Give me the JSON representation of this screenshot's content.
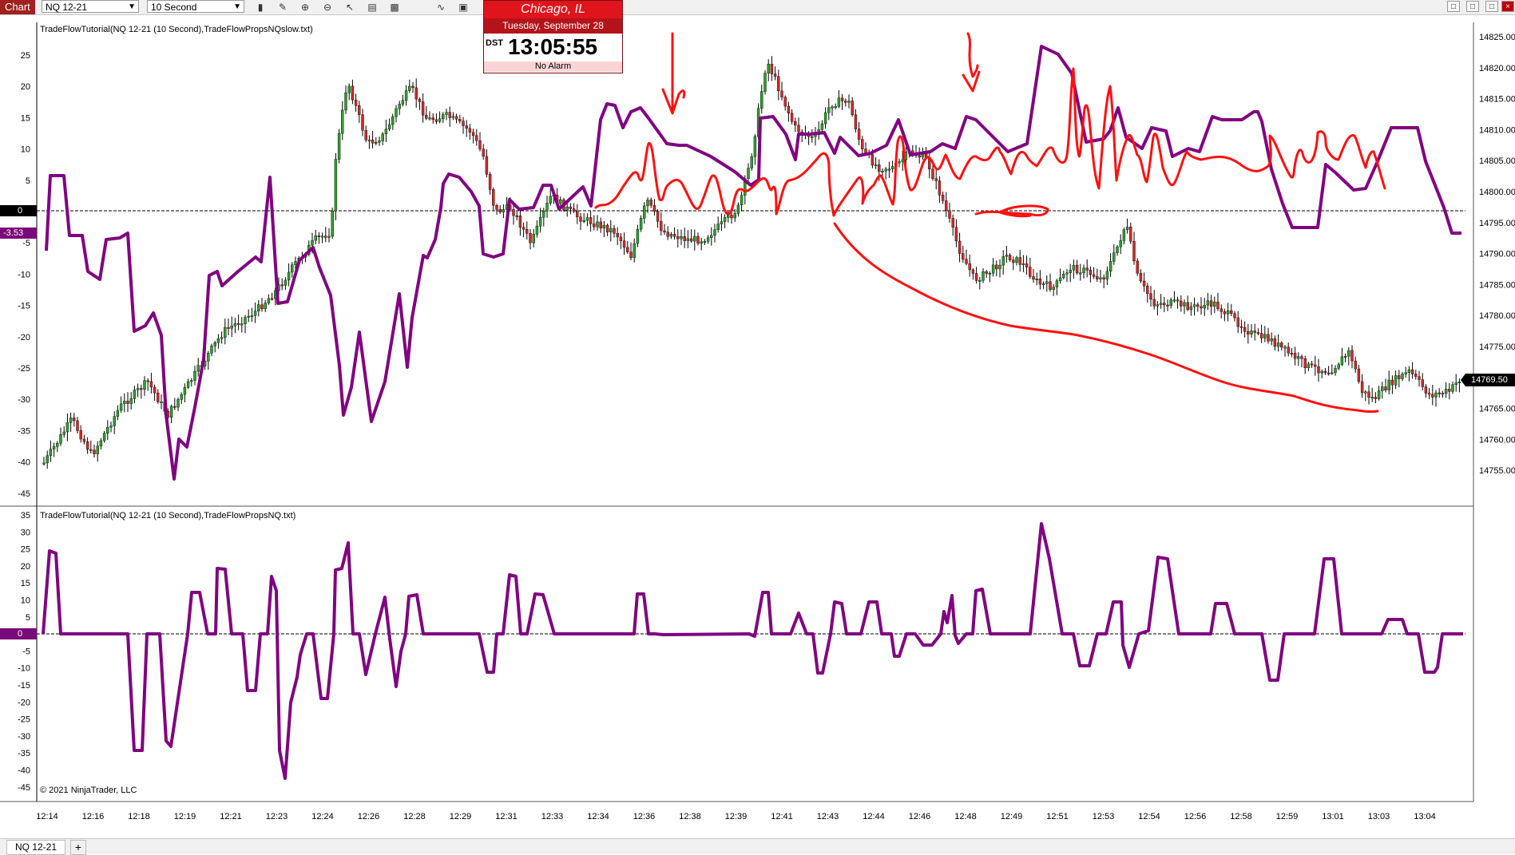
{
  "toolbar": {
    "chart_tab": "Chart",
    "instrument": "NQ 12-21",
    "interval": "10 Second"
  },
  "clock": {
    "city": "Chicago, IL",
    "date": "Tuesday, September 28",
    "dst": "DST",
    "time": "13:05:55",
    "alarm": "No Alarm"
  },
  "panels": {
    "top_title": "TradeFlowTutorial(NQ 12-21 (10 Second),TradeFlowPropsNQslow.txt)",
    "bottom_title": "TradeFlowTutorial(NQ 12-21 (10 Second),TradeFlowPropsNQ.txt)",
    "copyright": "© 2021 NinjaTrader, LLC"
  },
  "markers": {
    "top_zero": "0",
    "top_value": "-3.53",
    "bottom_zero": "0",
    "price": "14769.50"
  },
  "axes": {
    "left_top": [
      "25",
      "20",
      "15",
      "10",
      "5",
      "0",
      "-5",
      "-10",
      "-15",
      "-20",
      "-25",
      "-30",
      "-35",
      "-40",
      "-45"
    ],
    "left_bottom": [
      "35",
      "30",
      "25",
      "20",
      "15",
      "10",
      "5",
      "0",
      "-5",
      "-10",
      "-15",
      "-20",
      "-25",
      "-30",
      "-35",
      "-40",
      "-45"
    ],
    "right_price": [
      "14825.00",
      "14820.00",
      "14815.00",
      "14810.00",
      "14805.00",
      "14800.00",
      "14795.00",
      "14790.00",
      "14785.00",
      "14780.00",
      "14775.00",
      "14770.00",
      "14765.00",
      "14760.00",
      "14755.00"
    ],
    "time": [
      "12:14",
      "12:16",
      "12:18",
      "12:19",
      "12:21",
      "12:23",
      "12:24",
      "12:26",
      "12:28",
      "12:29",
      "12:31",
      "12:33",
      "12:34",
      "12:36",
      "12:38",
      "12:39",
      "12:41",
      "12:43",
      "12:44",
      "12:46",
      "12:48",
      "12:49",
      "12:51",
      "12:53",
      "12:54",
      "12:56",
      "12:58",
      "12:59",
      "13:01",
      "13:03",
      "13:04"
    ]
  },
  "colors": {
    "up_candle": "#2ca02c",
    "down_candle": "#d62728",
    "indicator": "#800080",
    "annotation": "#ff1010"
  },
  "bottom_tab": {
    "label": "NQ 12-21",
    "add": "+"
  }
}
